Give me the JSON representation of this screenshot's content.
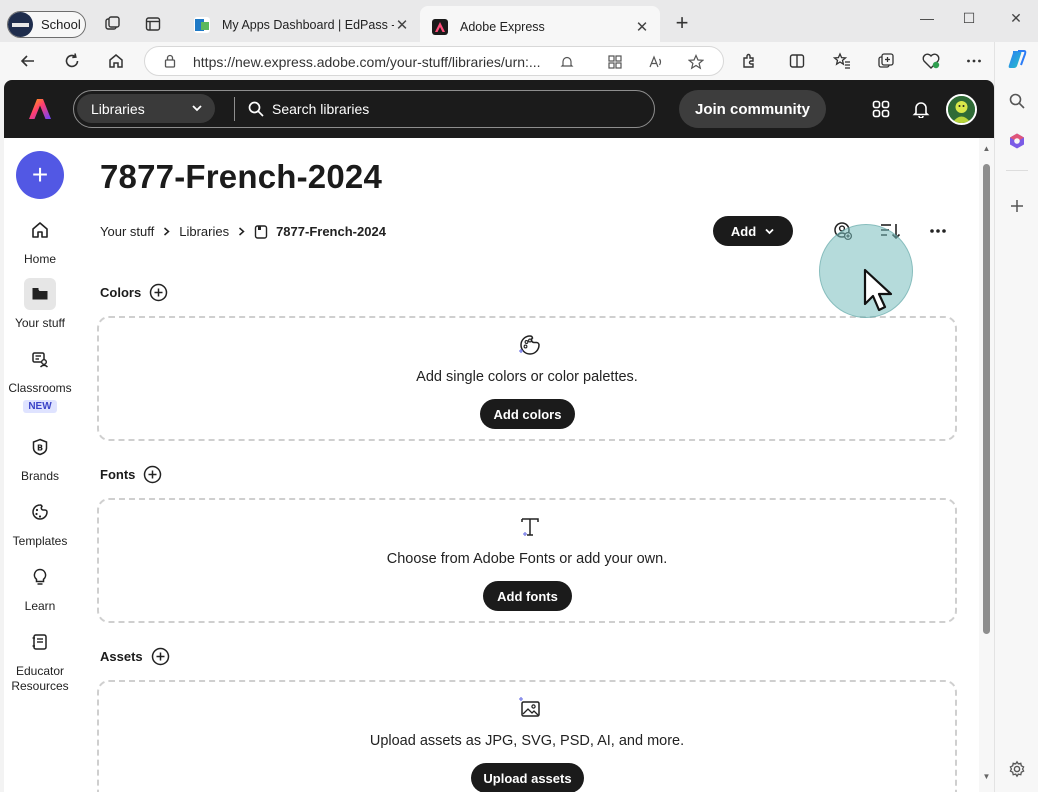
{
  "browser": {
    "profile_label": "School",
    "tabs": [
      {
        "title": "My Apps Dashboard | EdPass - Ed",
        "active": false
      },
      {
        "title": "Adobe Express",
        "active": true
      }
    ],
    "url": "https://new.express.adobe.com/your-stuff/libraries/urn:..."
  },
  "header": {
    "library_select": "Libraries",
    "search_placeholder": "Search libraries",
    "join_label": "Join community"
  },
  "rail": {
    "items": [
      {
        "label": "Home"
      },
      {
        "label": "Your stuff"
      },
      {
        "label": "Classrooms",
        "badge": "NEW"
      },
      {
        "label": "Brands"
      },
      {
        "label": "Templates"
      },
      {
        "label": "Learn"
      },
      {
        "label": "Educator\nResources"
      }
    ]
  },
  "main": {
    "title": "7877-French-2024",
    "breadcrumb": [
      "Your stuff",
      "Libraries",
      "7877-French-2024"
    ],
    "add_label": "Add",
    "sections": [
      {
        "title": "Colors",
        "message": "Add single colors or color palettes.",
        "button": "Add colors"
      },
      {
        "title": "Fonts",
        "message": "Choose from Adobe Fonts or add your own.",
        "button": "Add fonts"
      },
      {
        "title": "Assets",
        "message": "Upload assets as JPG, SVG, PSD, AI, and more.",
        "button": "Upload assets"
      }
    ]
  },
  "colors": {
    "accent": "#5258e4",
    "header_bg": "#1b1b1b",
    "button_bg": "#1b1b1b"
  }
}
